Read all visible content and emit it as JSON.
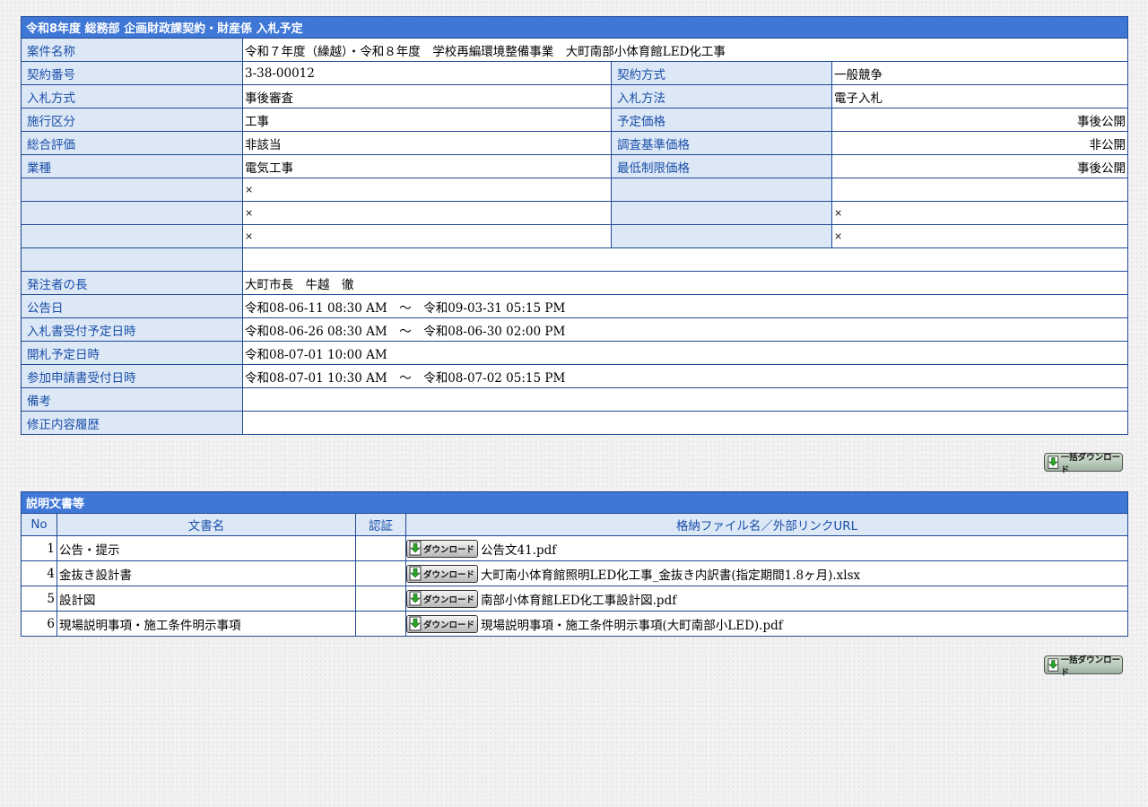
{
  "plan": {
    "title": "令和8年度 総務部 企画財政課契約・財産係 入札予定",
    "case_name": {
      "label": "案件名称",
      "value": "令和７年度（繰越）・令和８年度　学校再編環境整備事業　大町南部小体育館LED化工事"
    },
    "contract_no": {
      "label": "契約番号",
      "value": "3-38-00012"
    },
    "contract_method": {
      "label": "契約方式",
      "value": "一般競争"
    },
    "bid_type": {
      "label": "入札方式",
      "value": "事後審査"
    },
    "bid_method": {
      "label": "入札方法",
      "value": "電子入札"
    },
    "work_class": {
      "label": "施行区分",
      "value": "工事"
    },
    "planned_price": {
      "label": "予定価格",
      "value": "事後公開"
    },
    "overall_eval": {
      "label": "総合評価",
      "value": "非該当"
    },
    "survey_price": {
      "label": "調査基準価格",
      "value": "非公開"
    },
    "industry": {
      "label": "業種",
      "value": "電気工事"
    },
    "min_price": {
      "label": "最低制限価格",
      "value": "事後公開"
    },
    "blank_rows": [
      {
        "left": "×",
        "right": ""
      },
      {
        "left": "×",
        "right": "×"
      },
      {
        "left": "×",
        "right": "×"
      }
    ],
    "orderer": {
      "label": "発注者の長",
      "value": "大町市長　牛越　徹"
    },
    "notice_date": {
      "label": "公告日",
      "value": "令和08-06-11 08:30 AM　～　令和09-03-31 05:15 PM"
    },
    "bid_accept": {
      "label": "入札書受付予定日時",
      "value": "令和08-06-26 08:30 AM　～　令和08-06-30 02:00 PM"
    },
    "opening": {
      "label": "開札予定日時",
      "value": "令和08-07-01 10:00 AM"
    },
    "application": {
      "label": "参加申請書受付日時",
      "value": "令和08-07-01 10:30 AM　～　令和08-07-02 05:15 PM"
    },
    "remarks": {
      "label": "備考",
      "value": ""
    },
    "history": {
      "label": "修正内容履歴",
      "value": ""
    }
  },
  "bulk_download_label": "一括ダウンロード",
  "docs": {
    "title": "説明文書等",
    "headers": {
      "no": "No",
      "name": "文書名",
      "auth": "認証",
      "file": "格納ファイル名／外部リンクURL"
    },
    "download_label": "ダウンロード",
    "rows": [
      {
        "no": "1",
        "name": "公告・提示",
        "auth": "",
        "file": "公告文41.pdf"
      },
      {
        "no": "4",
        "name": "金抜き設計書",
        "auth": "",
        "file": "大町南小体育館照明LED化工事_金抜き内訳書(指定期間1.8ヶ月).xlsx"
      },
      {
        "no": "5",
        "name": "設計図",
        "auth": "",
        "file": "南部小体育館LED化工事設計図.pdf"
      },
      {
        "no": "6",
        "name": "現場説明事項・施工条件明示事項",
        "auth": "",
        "file": "現場説明事項・施工条件明示事項(大町南部小LED).pdf"
      }
    ]
  },
  "colors": {
    "header_bg": "#3f77d6",
    "label_bg": "#dde8f7",
    "label_text": "#1a4fa8",
    "border": "#1f4a96"
  },
  "icons": {
    "download": "download-arrow-icon"
  }
}
